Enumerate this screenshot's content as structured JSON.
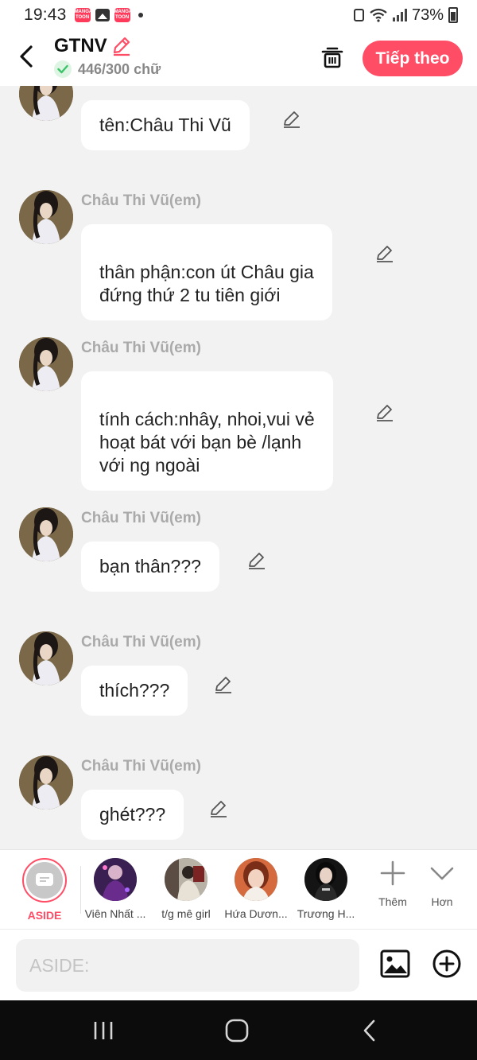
{
  "status_bar": {
    "time": "19:43",
    "app_badge_text": "MANGA TOON",
    "battery": "73%"
  },
  "header": {
    "title": "GTNV",
    "counter": "446/300 chữ",
    "next_label": "Tiếp theo",
    "accent_color": "#ff4d66"
  },
  "messages": [
    {
      "sender": "",
      "text": "tên:Châu Thi Vũ"
    },
    {
      "sender": "Châu Thi Vũ(em)",
      "text": "thân phận:con út Châu gia\nđứng thứ 2 tu tiên giới"
    },
    {
      "sender": "Châu Thi Vũ(em)",
      "text": "tính cách:nhây, nhoi,vui vẻ\nhoạt bát với bạn bè /lạnh\nvới ng ngoài"
    },
    {
      "sender": "Châu Thi Vũ(em)",
      "text": "bạn thân???"
    },
    {
      "sender": "Châu Thi Vũ(em)",
      "text": "thích???"
    },
    {
      "sender": "Châu Thi Vũ(em)",
      "text": "ghét???"
    }
  ],
  "characters": [
    {
      "label": "ASIDE"
    },
    {
      "label": "Viên Nhất ..."
    },
    {
      "label": "t/g mê girl"
    },
    {
      "label": "Hứa Dươn..."
    },
    {
      "label": "Trương H..."
    }
  ],
  "tools": {
    "add_label": "Thêm",
    "more_label": "Hơn"
  },
  "input": {
    "placeholder": "ASIDE:"
  }
}
